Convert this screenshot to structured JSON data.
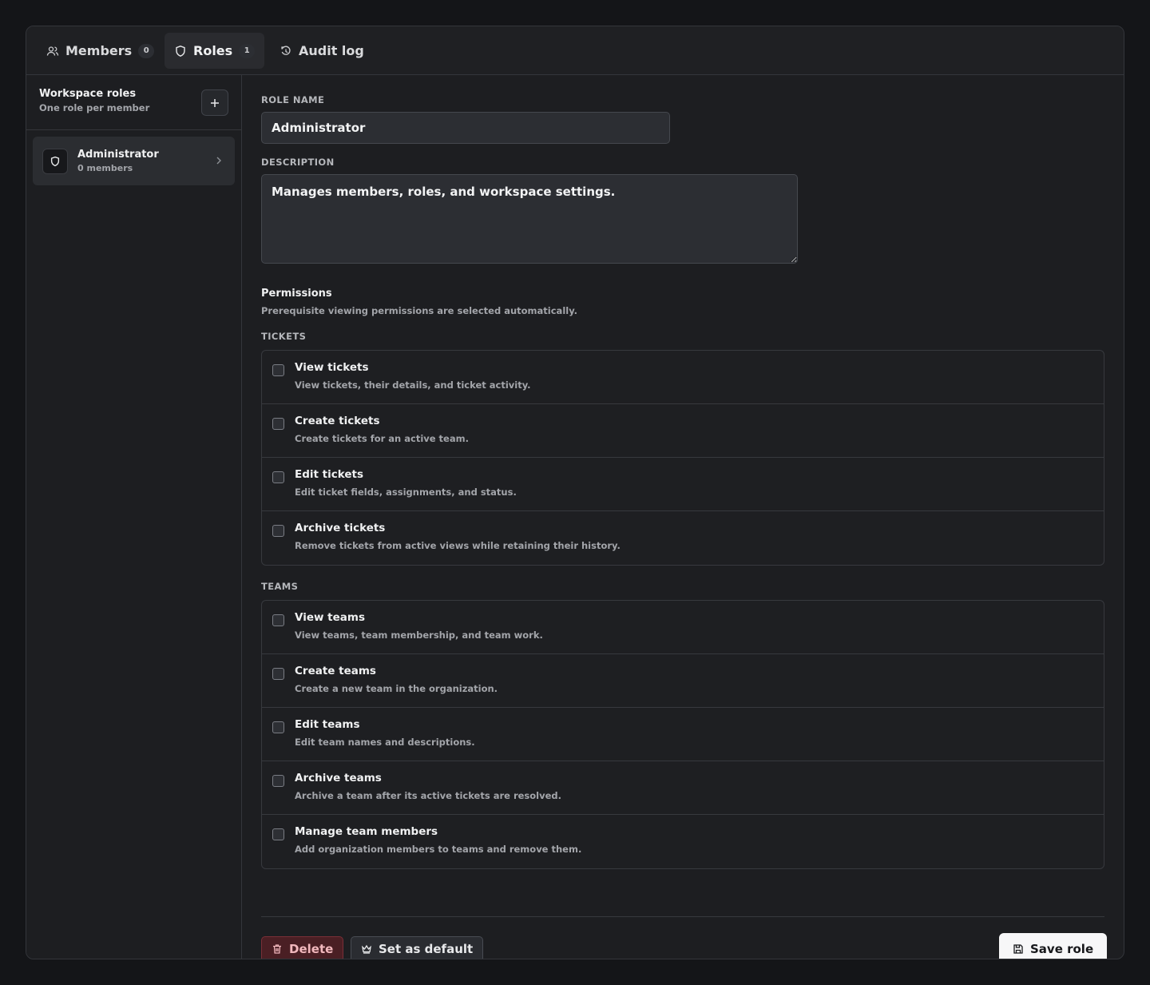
{
  "tabs": [
    {
      "label": "Members",
      "count": "0",
      "icon": "users-icon",
      "active": false
    },
    {
      "label": "Roles",
      "count": "1",
      "icon": "shield-icon",
      "active": true
    },
    {
      "label": "Audit log",
      "icon": "clock-icon",
      "active": false
    }
  ],
  "sidebar": {
    "title": "Workspace roles",
    "subtitle": "One role per member",
    "add_icon": "plus-icon",
    "roles": [
      {
        "name": "Administrator",
        "members": "0 members"
      }
    ]
  },
  "form": {
    "role_name_label": "ROLE NAME",
    "role_name_value": "Administrator",
    "description_label": "DESCRIPTION",
    "description_value": "Manages members, roles, and workspace settings."
  },
  "permissions": {
    "title": "Permissions",
    "subtitle": "Prerequisite viewing permissions are selected automatically.",
    "groups": [
      {
        "label": "TICKETS",
        "items": [
          {
            "name": "View tickets",
            "desc": "View tickets, their details, and ticket activity.",
            "checked": false
          },
          {
            "name": "Create tickets",
            "desc": "Create tickets for an active team.",
            "checked": false
          },
          {
            "name": "Edit tickets",
            "desc": "Edit ticket fields, assignments, and status.",
            "checked": false
          },
          {
            "name": "Archive tickets",
            "desc": "Remove tickets from active views while retaining their history.",
            "checked": false
          }
        ]
      },
      {
        "label": "TEAMS",
        "items": [
          {
            "name": "View teams",
            "desc": "View teams, team membership, and team work.",
            "checked": false
          },
          {
            "name": "Create teams",
            "desc": "Create a new team in the organization.",
            "checked": false
          },
          {
            "name": "Edit teams",
            "desc": "Edit team names and descriptions.",
            "checked": false
          },
          {
            "name": "Archive teams",
            "desc": "Archive a team after its active tickets are resolved.",
            "checked": false
          },
          {
            "name": "Manage team members",
            "desc": "Add organization members to teams and remove them.",
            "checked": false
          }
        ]
      }
    ]
  },
  "actions": {
    "delete_label": "Delete",
    "default_label": "Set as default",
    "save_label": "Save role"
  },
  "colors": {
    "background": "#141518",
    "panel": "#1d1e21",
    "danger": "#7a2f37",
    "primary_button": "#f7f7f8"
  }
}
